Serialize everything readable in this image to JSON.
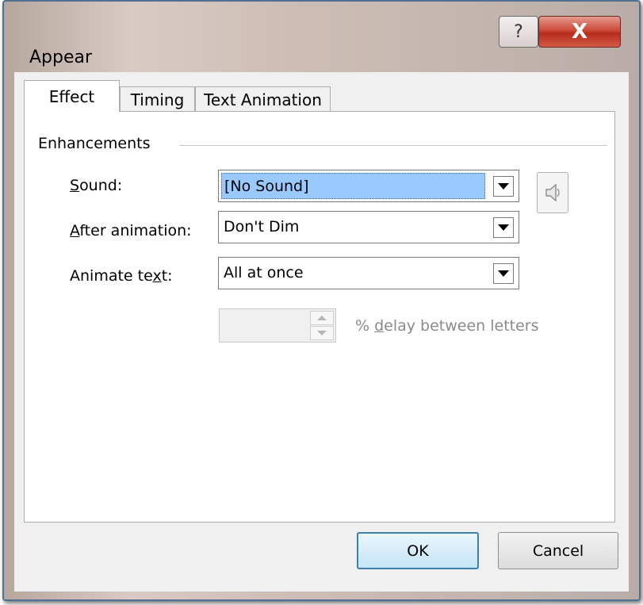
{
  "window": {
    "title": "Appear",
    "help_glyph": "?",
    "close_glyph": "X"
  },
  "tabs": [
    {
      "label": "Effect",
      "active": true
    },
    {
      "label": "Timing",
      "active": false
    },
    {
      "label": "Text Animation",
      "active": false
    }
  ],
  "enhancements": {
    "group_label": "Enhancements",
    "sound": {
      "label_accel": "S",
      "label_rest": "ound:",
      "value": "[No Sound]"
    },
    "after_animation": {
      "label_accel": "A",
      "label_rest": "fter animation:",
      "value": "Don't Dim"
    },
    "animate_text": {
      "label_pre": "Animate te",
      "label_accel": "x",
      "label_rest": "t:",
      "value": "All at once"
    },
    "delay": {
      "value": "",
      "label_pre": "% ",
      "label_accel": "d",
      "label_rest": "elay between letters"
    }
  },
  "buttons": {
    "ok": "OK",
    "cancel": "Cancel"
  },
  "icons": {
    "sound": "speaker-icon",
    "dropdown": "chevron-down-icon",
    "spin_up": "spin-up-icon",
    "spin_down": "spin-down-icon"
  }
}
